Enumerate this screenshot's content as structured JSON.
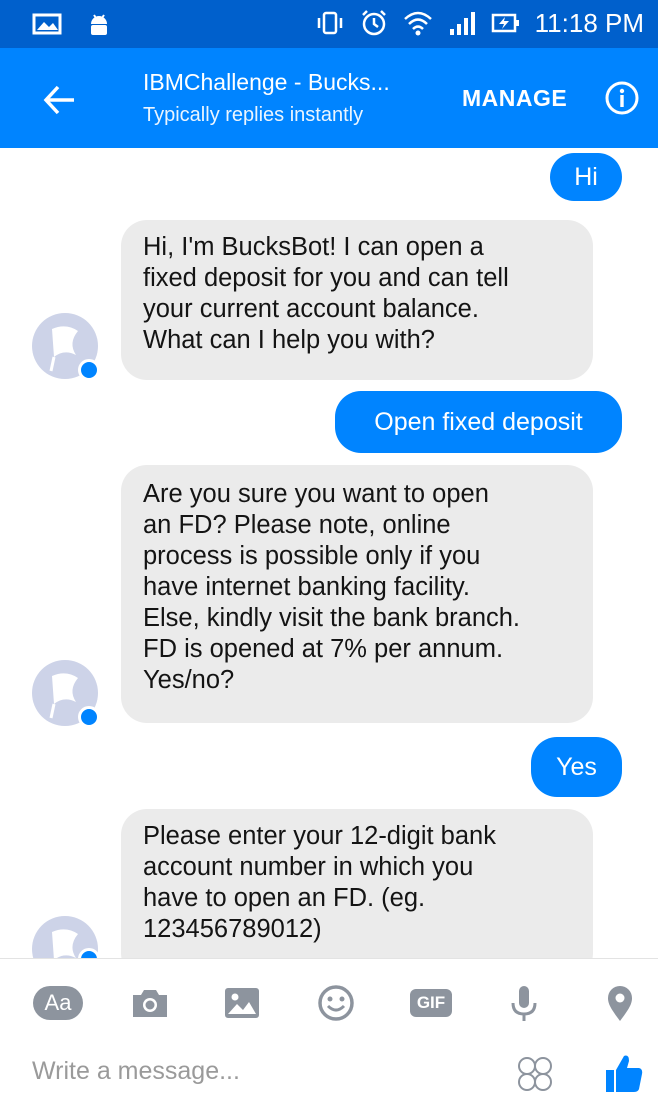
{
  "status_bar": {
    "time": "11:18 PM",
    "icons": [
      "gallery-icon",
      "android-icon",
      "vibrate-icon",
      "alarm-icon",
      "wifi-icon",
      "signal-icon",
      "battery-charging-icon"
    ]
  },
  "header": {
    "back_icon": "arrow-left-icon",
    "title": "IBMChallenge - Bucks...",
    "subtitle": "Typically replies instantly",
    "manage_label": "MANAGE",
    "info_icon": "info-icon"
  },
  "messages": [
    {
      "from": "me",
      "text": "Hi"
    },
    {
      "from": "bot",
      "text": "Hi, I'm BucksBot! I can open a\nfixed deposit for you and can tell\nyour current account balance.\nWhat can I help you with?"
    },
    {
      "from": "me",
      "text": "Open fixed deposit"
    },
    {
      "from": "bot",
      "text": "Are you sure you want to open\nan FD? Please note, online\nprocess is possible only if you\nhave internet banking facility.\nElse, kindly visit the bank branch.\nFD is opened at 7% per annum.\nYes/no?"
    },
    {
      "from": "me",
      "text": "Yes"
    },
    {
      "from": "bot",
      "text": "Please enter your 12-digit bank\naccount number in which you\nhave to open an FD. (eg.\n123456789012)"
    }
  ],
  "composer": {
    "text_mode_label": "Aa",
    "gif_label": "GIF",
    "placeholder": "Write a message...",
    "tools": [
      "camera-icon",
      "image-icon",
      "emoji-icon",
      "gif-icon",
      "microphone-icon",
      "location-icon"
    ]
  },
  "colors": {
    "status_bar": "#0060cc",
    "header": "#0084ff",
    "outgoing_bubble": "#0084ff",
    "incoming_bubble": "#ebebeb"
  }
}
